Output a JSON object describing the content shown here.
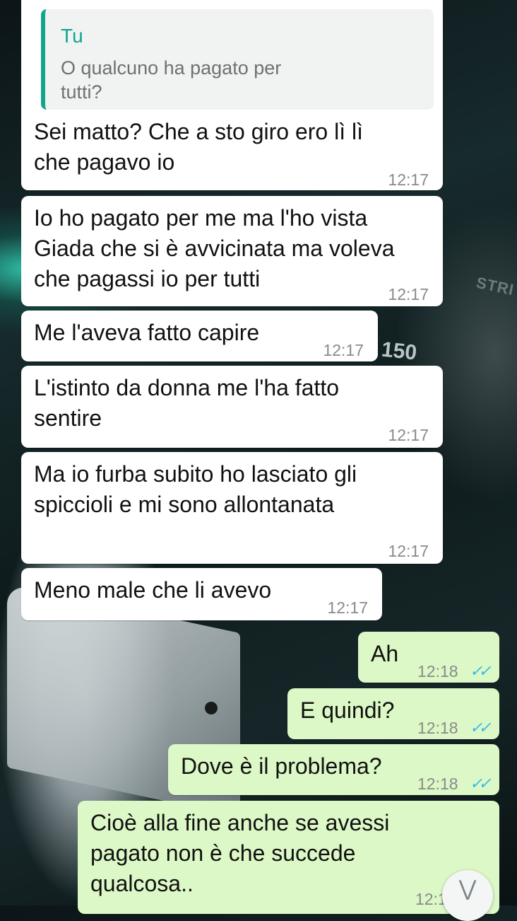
{
  "quoted_reply": {
    "author": "Tu",
    "text": "O qualcuno ha pagato per\ntutti?"
  },
  "background": {
    "text_a": "STRI",
    "text_b": "150"
  },
  "messages": [
    {
      "text": "Sei matto? Che a sto giro ero lì lì\nche pagavo io",
      "time": "12:17",
      "direction": "incoming"
    },
    {
      "text": "Io ho pagato per me ma l'ho vista\nGiada che si è avvicinata ma voleva\nche pagassi io per tutti",
      "time": "12:17",
      "direction": "incoming"
    },
    {
      "text": "Me l'aveva fatto capire",
      "time": "12:17",
      "direction": "incoming"
    },
    {
      "text": "L'istinto da donna me l'ha fatto\nsentire",
      "time": "12:17",
      "direction": "incoming"
    },
    {
      "text": "Ma io furba subito ho lasciato gli\nspiccioli e mi sono allontanata",
      "time": "12:17",
      "direction": "incoming"
    },
    {
      "text": "Meno male che li avevo",
      "time": "12:17",
      "direction": "incoming"
    },
    {
      "text": "Ah",
      "time": "12:18",
      "direction": "outgoing",
      "ticks": "✓✓"
    },
    {
      "text": "E quindi?",
      "time": "12:18",
      "direction": "outgoing",
      "ticks": "✓✓"
    },
    {
      "text": "Dove è il problema?",
      "time": "12:18",
      "direction": "outgoing",
      "ticks": "✓✓"
    },
    {
      "text": "Cioè alla fine anche se avessi\npagato non è che succede\nqualcosa..",
      "time": "12:1",
      "direction": "outgoing"
    }
  ],
  "scroll_button_icon": "double-chevron-down-icon",
  "colors": {
    "incoming": "#ffffff",
    "outgoing": "#dcf8c6",
    "quote_accent": "#12a58e",
    "read_ticks": "#34b7f1"
  }
}
